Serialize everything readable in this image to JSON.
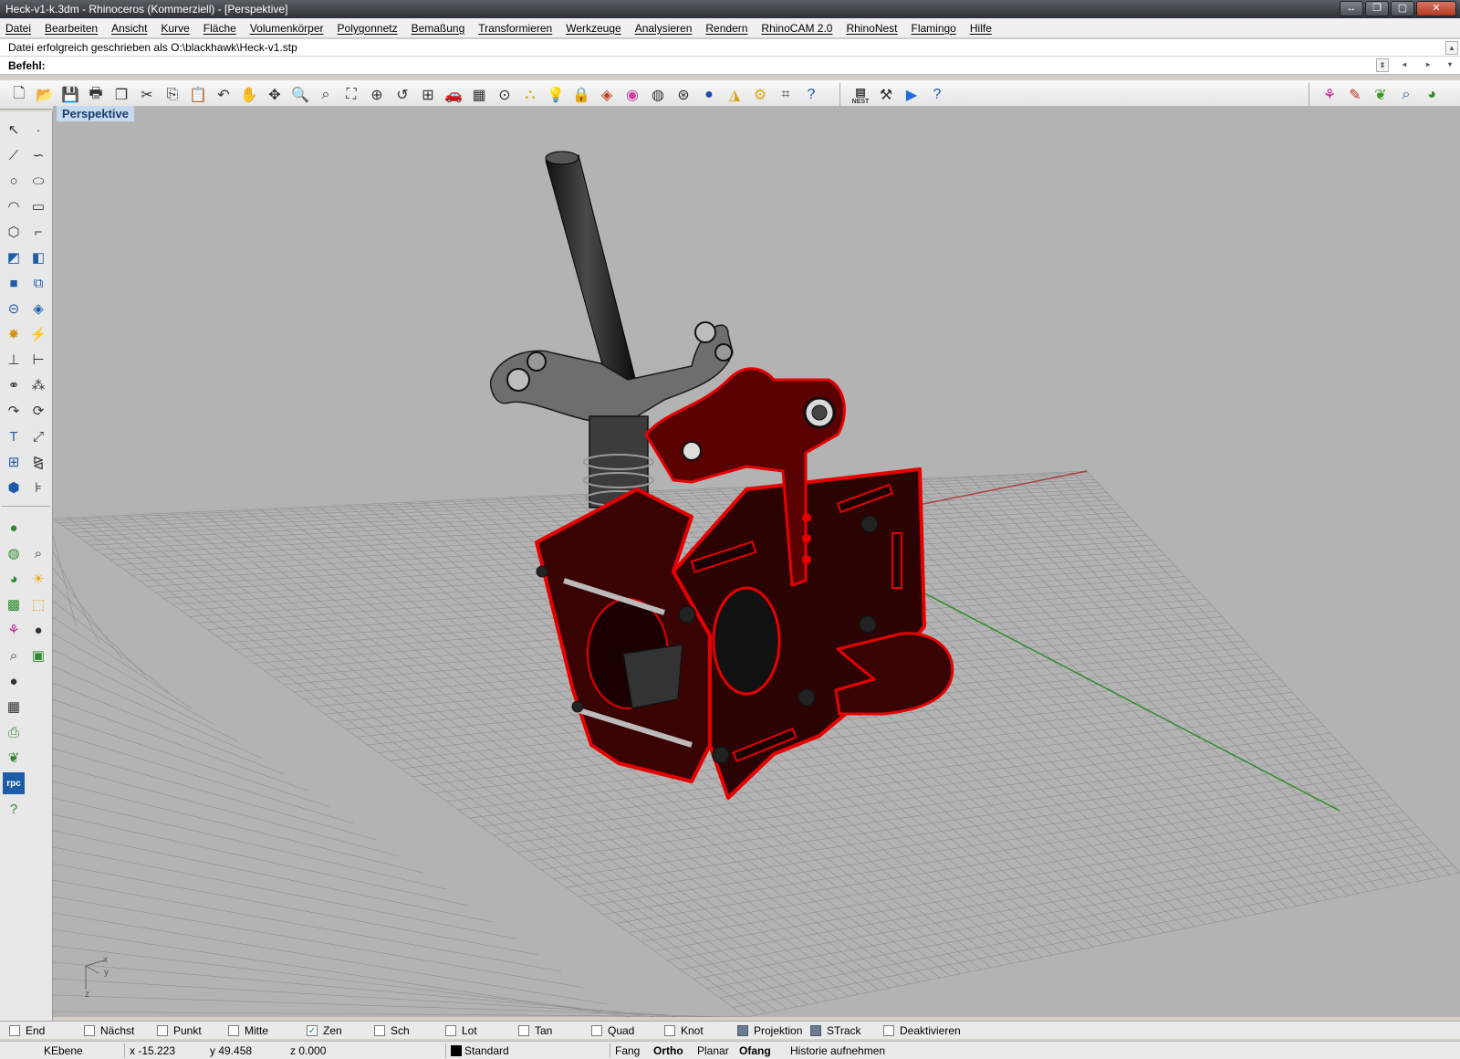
{
  "window": {
    "title": "Heck-v1-k.3dm - Rhinoceros (Kommerziell) - [Perspektive]",
    "controls": [
      "↔",
      "❐",
      "▢",
      "✕"
    ]
  },
  "menu": [
    "Datei",
    "Bearbeiten",
    "Ansicht",
    "Kurve",
    "Fläche",
    "Volumenkörper",
    "Polygonnetz",
    "Bemaßung",
    "Transformieren",
    "Werkzeuge",
    "Analysieren",
    "Rendern",
    "RhinoCAM 2.0",
    "RhinoNest",
    "Flamingo",
    "Hilfe"
  ],
  "command": {
    "history": "Datei erfolgreich geschrieben als O:\\blackhawk\\Heck-v1.stp",
    "prompt": "Befehl:"
  },
  "viewport": {
    "title": "Perspektive",
    "axis_labels": {
      "x": "x",
      "y": "y",
      "z": "z"
    }
  },
  "toolbar": {
    "nest_label": "NEST"
  },
  "osnaps": [
    {
      "label": "End",
      "checked": false
    },
    {
      "label": "Nächst",
      "checked": false
    },
    {
      "label": "Punkt",
      "checked": false
    },
    {
      "label": "Mitte",
      "checked": false
    },
    {
      "label": "Zen",
      "checked": true
    },
    {
      "label": "Sch",
      "checked": false
    },
    {
      "label": "Lot",
      "checked": false
    },
    {
      "label": "Tan",
      "checked": false
    },
    {
      "label": "Quad",
      "checked": false
    },
    {
      "label": "Knot",
      "checked": false
    },
    {
      "label": "Projektion",
      "checked": false,
      "style": "filled"
    },
    {
      "label": "STrack",
      "checked": false,
      "style": "filled"
    },
    {
      "label": "Deaktivieren",
      "checked": false
    }
  ],
  "status": {
    "plane": "KEbene",
    "x": "x -15.223",
    "y": "y 49.458",
    "z": "z 0.000",
    "layer": "Standard",
    "fang": "Fang",
    "ortho": "Ortho",
    "planar": "Planar",
    "ofang": "Ofang",
    "history": "Historie aufnehmen"
  },
  "colors": {
    "selection": "#e60000",
    "viewport_bg": "#b3b3b3",
    "grid": "#8e8e8e",
    "x_axis": "#b04040",
    "y_axis": "#2e8a2e"
  }
}
